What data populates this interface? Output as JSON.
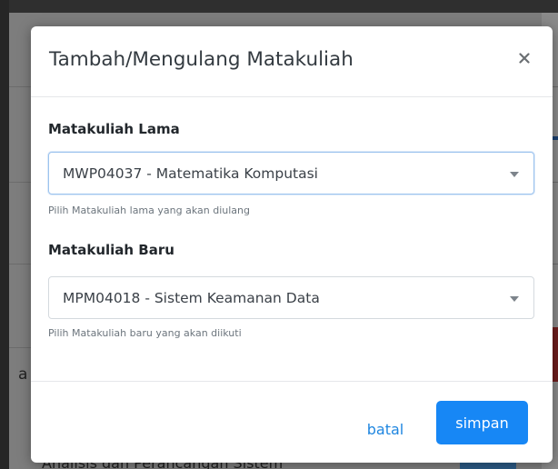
{
  "background": {
    "bottom_text": "Analisis dan Perancangan Sistem",
    "left_fragment": "a"
  },
  "modal": {
    "title": "Tambah/Mengulang Matakuliah",
    "close_icon": "close-icon",
    "fields": [
      {
        "label": "Matakuliah Lama",
        "selected_value": "MWP04037 - Matematika Komputasi",
        "help_text": "Pilih Matakuliah lama yang akan diulang"
      },
      {
        "label": "Matakuliah Baru",
        "selected_value": "MPM04018 - Sistem Keamanan Data",
        "help_text": "Pilih Matakuliah baru yang akan diikuti"
      }
    ],
    "footer": {
      "cancel_label": "batal",
      "save_label": "simpan"
    }
  },
  "colors": {
    "primary": "#1787f5",
    "link": "#1f86e0",
    "focus_border": "#9cc3ee"
  }
}
